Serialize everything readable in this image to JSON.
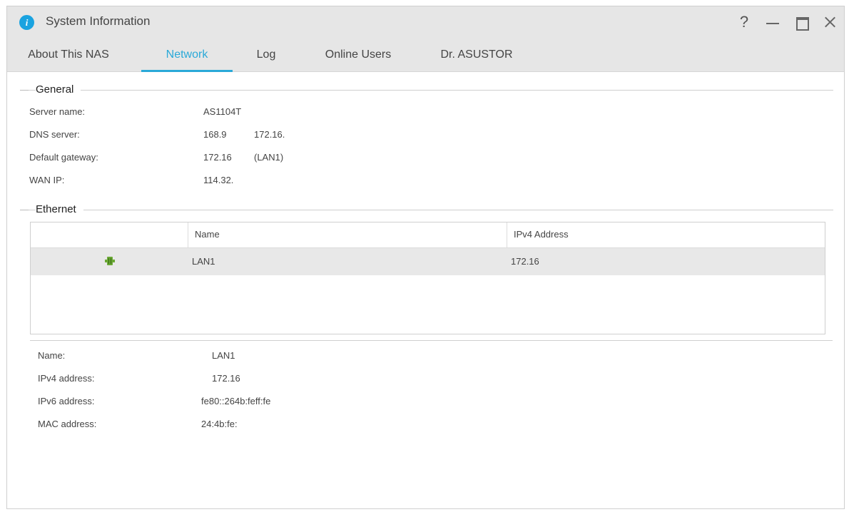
{
  "window": {
    "title": "System Information",
    "controls": {
      "help": "?",
      "minimize": "",
      "maximize": "",
      "close": ""
    }
  },
  "tabs": [
    {
      "label": "About This NAS",
      "active": false
    },
    {
      "label": "Network",
      "active": true
    },
    {
      "label": "Log",
      "active": false
    },
    {
      "label": "Online Users",
      "active": false
    },
    {
      "label": "Dr. ASUSTOR",
      "active": false
    }
  ],
  "general": {
    "heading": "General",
    "server_name": {
      "label": "Server name:",
      "value": "AS1104T"
    },
    "dns_server": {
      "label": "DNS server:",
      "value1": "168.9",
      "value2": "172.16."
    },
    "default_gateway": {
      "label": "Default gateway:",
      "value1": "172.16",
      "value2": "(LAN1)"
    },
    "wan_ip": {
      "label": "WAN IP:",
      "value": "114.32."
    }
  },
  "ethernet": {
    "heading": "Ethernet",
    "columns": {
      "name": "Name",
      "ipv4": "IPv4 Address"
    },
    "rows": [
      {
        "icon": "ethernet-port-icon",
        "name": "LAN1",
        "ipv4": "172.16"
      }
    ],
    "details": {
      "name": {
        "label": "Name:",
        "value": "LAN1"
      },
      "ipv4": {
        "label": "IPv4 address:",
        "value": "172.16"
      },
      "ipv6": {
        "label": "IPv6 address:",
        "value": "fe80::264b:feff:fe"
      },
      "mac": {
        "label": "MAC address:",
        "value": "24:4b:fe:"
      }
    }
  },
  "colors": {
    "accent": "#2aa9d8",
    "icon_green": "#6aa834",
    "titlebar": "#e6e6e6"
  }
}
